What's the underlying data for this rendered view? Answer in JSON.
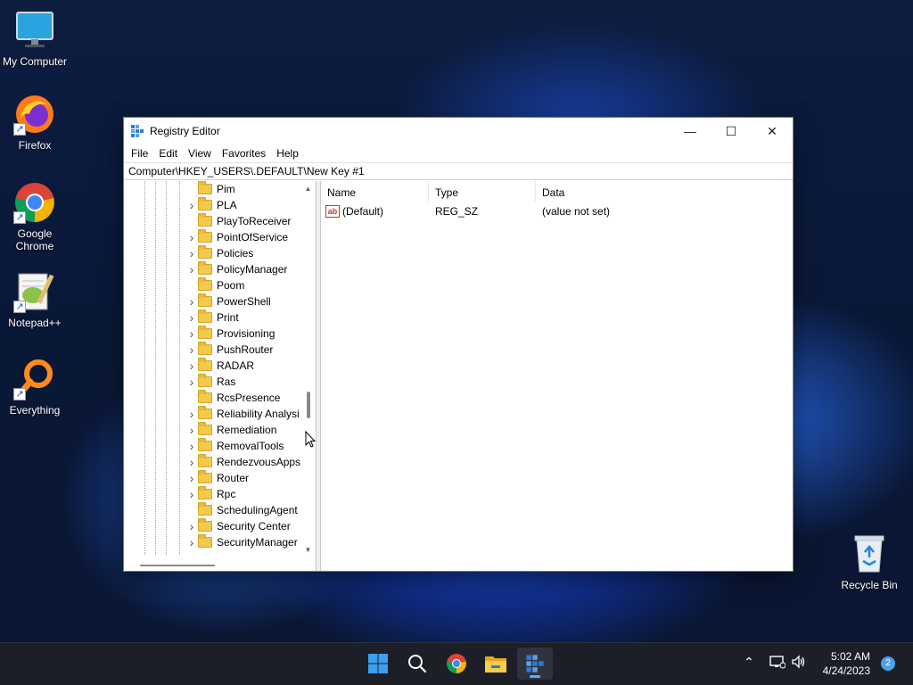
{
  "desktop": {
    "icons": [
      {
        "label": "My Computer",
        "icon": "monitor-icon"
      },
      {
        "label": "Firefox",
        "icon": "firefox-icon"
      },
      {
        "label": "Google\nChrome",
        "icon": "chrome-icon"
      },
      {
        "label": "Notepad++",
        "icon": "notepadpp-icon"
      },
      {
        "label": "Everything",
        "icon": "everything-search-icon"
      },
      {
        "label": "Recycle Bin",
        "icon": "recycle-bin-icon"
      }
    ]
  },
  "window": {
    "title": "Registry Editor",
    "controls": {
      "minimize": "—",
      "maximize": "☐",
      "close": "✕"
    },
    "menu": [
      "File",
      "Edit",
      "View",
      "Favorites",
      "Help"
    ],
    "address": "Computer\\HKEY_USERS\\.DEFAULT\\New Key #1",
    "tree": {
      "items": [
        {
          "label": "Pim",
          "expandable": false
        },
        {
          "label": "PLA",
          "expandable": true
        },
        {
          "label": "PlayToReceiver",
          "expandable": false
        },
        {
          "label": "PointOfService",
          "expandable": true
        },
        {
          "label": "Policies",
          "expandable": true
        },
        {
          "label": "PolicyManager",
          "expandable": true
        },
        {
          "label": "Poom",
          "expandable": false
        },
        {
          "label": "PowerShell",
          "expandable": true
        },
        {
          "label": "Print",
          "expandable": true
        },
        {
          "label": "Provisioning",
          "expandable": true
        },
        {
          "label": "PushRouter",
          "expandable": true
        },
        {
          "label": "RADAR",
          "expandable": true
        },
        {
          "label": "Ras",
          "expandable": true
        },
        {
          "label": "RcsPresence",
          "expandable": false
        },
        {
          "label": "Reliability Analysi",
          "expandable": true
        },
        {
          "label": "Remediation",
          "expandable": true
        },
        {
          "label": "RemovalTools",
          "expandable": true
        },
        {
          "label": "RendezvousApps",
          "expandable": true
        },
        {
          "label": "Router",
          "expandable": true
        },
        {
          "label": "Rpc",
          "expandable": true
        },
        {
          "label": "SchedulingAgent",
          "expandable": false
        },
        {
          "label": "Security Center",
          "expandable": true
        },
        {
          "label": "SecurityManager",
          "expandable": true
        }
      ]
    },
    "list": {
      "columns": [
        "Name",
        "Type",
        "Data"
      ],
      "rows": [
        {
          "name": "(Default)",
          "type": "REG_SZ",
          "data": "(value not set)",
          "icon": "string-value-icon"
        }
      ]
    }
  },
  "taskbar": {
    "apps": [
      {
        "name": "start-button",
        "icon": "windows-logo-icon"
      },
      {
        "name": "search-button",
        "icon": "search-icon"
      },
      {
        "name": "chrome-taskbar",
        "icon": "chrome-icon"
      },
      {
        "name": "file-explorer-taskbar",
        "icon": "folder-icon"
      },
      {
        "name": "regedit-taskbar",
        "icon": "regedit-icon",
        "active": true
      }
    ],
    "tray": {
      "time": "5:02 AM",
      "date": "4/24/2023",
      "notifications": "2"
    }
  },
  "colors": {
    "accent": "#5ab0f2",
    "folder": "#f2c94c",
    "taskbar": "#1c1f27"
  }
}
